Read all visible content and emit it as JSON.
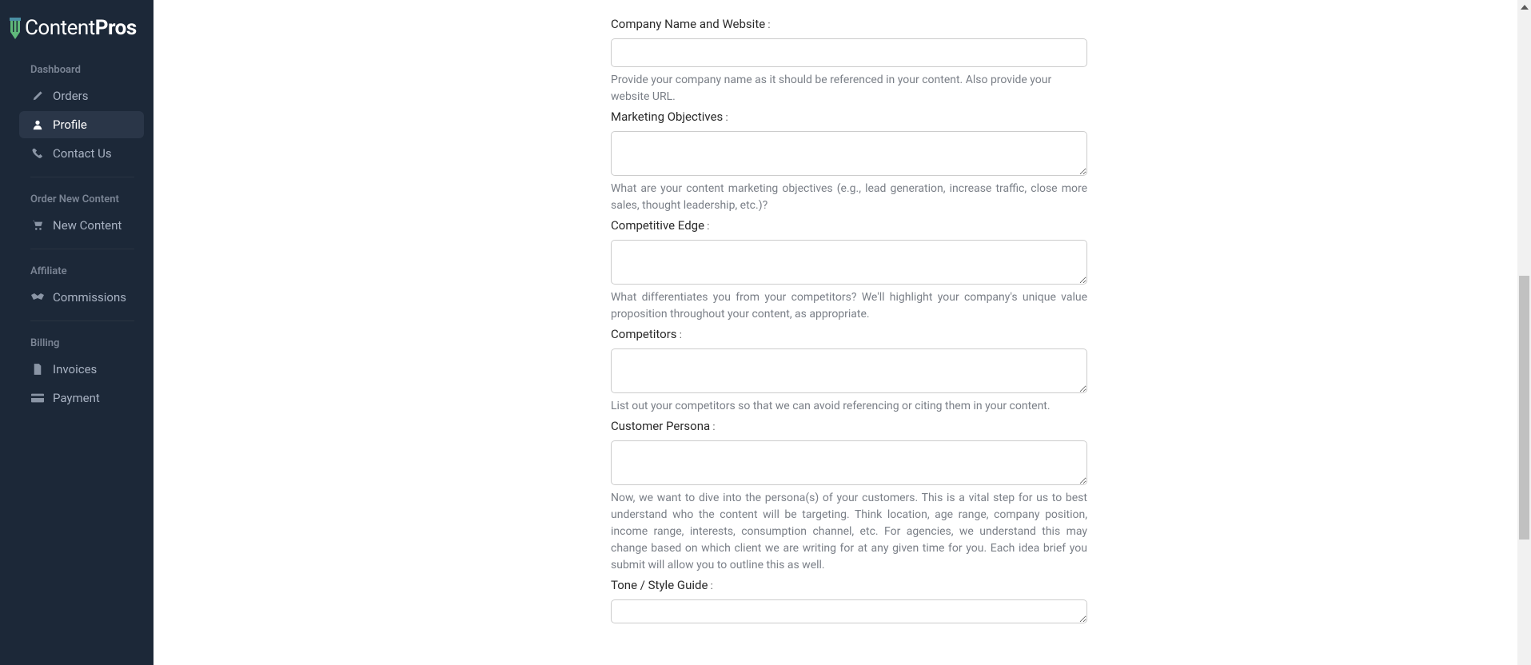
{
  "logo": {
    "brand_a": "Content",
    "brand_b": "Pros"
  },
  "sections": {
    "dashboard": {
      "header": "Dashboard",
      "items": [
        {
          "label": "Orders",
          "key": "orders"
        },
        {
          "label": "Profile",
          "key": "profile"
        },
        {
          "label": "Contact Us",
          "key": "contact"
        }
      ]
    },
    "order_new": {
      "header": "Order New Content",
      "items": [
        {
          "label": "New Content",
          "key": "new-content"
        }
      ]
    },
    "affiliate": {
      "header": "Affiliate",
      "items": [
        {
          "label": "Commissions",
          "key": "commissions"
        }
      ]
    },
    "billing": {
      "header": "Billing",
      "items": [
        {
          "label": "Invoices",
          "key": "invoices"
        },
        {
          "label": "Payment",
          "key": "payment"
        }
      ]
    }
  },
  "form": {
    "company": {
      "label": "Company Name and Website",
      "help": "Provide your company name as it should be referenced in your content. Also provide your website URL."
    },
    "objectives": {
      "label": "Marketing Objectives",
      "help": "What are your content marketing objectives (e.g., lead generation, increase traffic, close more sales, thought leadership, etc.)?"
    },
    "edge": {
      "label": "Competitive Edge",
      "help": "What differentiates you from your competitors? We'll highlight your company's unique value proposition throughout your content, as appropriate."
    },
    "competitors": {
      "label": "Competitors",
      "help": "List out your competitors so that we can avoid referencing or citing them in your content."
    },
    "persona": {
      "label": "Customer Persona",
      "help": "Now, we want to dive into the persona(s) of your customers. This is a vital step for us to best understand who the content will be targeting. Think location, age range, company position, income range, interests, consumption channel, etc. For agencies, we understand this may change based on which client we are writing for at any given time for you. Each idea brief you submit will allow you to outline this as well."
    },
    "tone": {
      "label": "Tone / Style Guide"
    }
  }
}
